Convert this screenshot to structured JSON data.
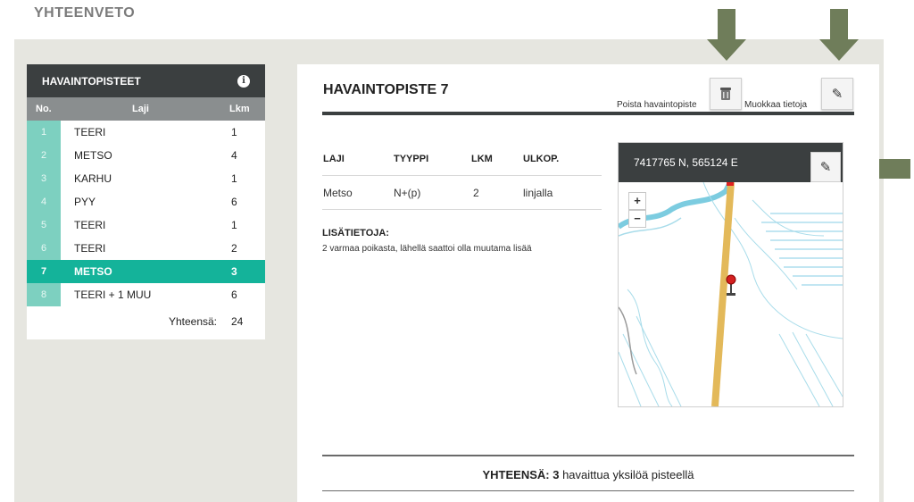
{
  "page": {
    "title": "YHTEENVETO"
  },
  "left_panel": {
    "title": "HAVAINTOPISTEET",
    "info_icon": "info-icon",
    "columns": {
      "no": "No.",
      "laji": "Laji",
      "lkm": "Lkm"
    },
    "rows": [
      {
        "no": "1",
        "laji": "TEERI",
        "lkm": "1"
      },
      {
        "no": "2",
        "laji": "METSO",
        "lkm": "4"
      },
      {
        "no": "3",
        "laji": "KARHU",
        "lkm": "1"
      },
      {
        "no": "4",
        "laji": "PYY",
        "lkm": "6"
      },
      {
        "no": "5",
        "laji": "TEERI",
        "lkm": "1"
      },
      {
        "no": "6",
        "laji": "TEERI",
        "lkm": "2"
      },
      {
        "no": "7",
        "laji": "METSO",
        "lkm": "3"
      },
      {
        "no": "8",
        "laji": "TEERI + 1 MUU",
        "lkm": "6"
      }
    ],
    "selected_row": "7",
    "total_label": "Yhteensä:",
    "total_value": "24"
  },
  "detail": {
    "title": "HAVAINTOPISTE 7",
    "delete_label": "Poista havaintopiste",
    "edit_label": "Muokkaa tietoja",
    "table": {
      "headers": [
        "LAJI",
        "TYYPPI",
        "LKM",
        "ULKOP."
      ],
      "row": [
        "Metso",
        "N+(p)",
        "2",
        "linjalla"
      ]
    },
    "info_heading": "LISÄTIETOJA:",
    "info_text": "2 varmaa poikasta, lähellä saattoi olla muutama lisää",
    "map": {
      "coordinates": "7417765 N, 565124 E",
      "zoom_in": "+",
      "zoom_out": "−"
    },
    "footer": {
      "bold": "YHTEENSÄ: 3",
      "rest": " havaittua yksilöä pisteellä"
    }
  },
  "colors": {
    "accent": "#14b39a",
    "accent_light": "#7dd0c0",
    "dark": "#3b3f40",
    "arrow": "#6f7d5a"
  }
}
